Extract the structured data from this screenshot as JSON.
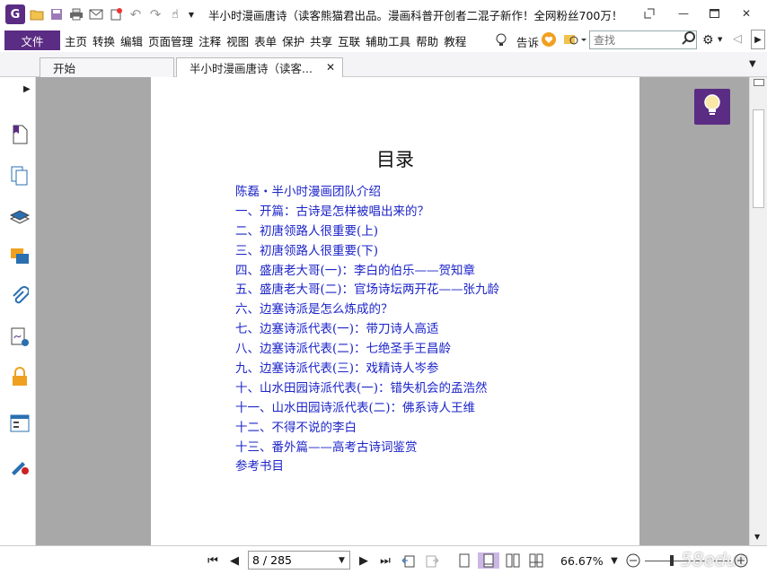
{
  "app": {
    "window_title": "半小时漫画唐诗（读客熊猫君出品。漫画科普开创者二混子新作！全网粉丝700万！",
    "accent_color": "#5b2c83",
    "icons": [
      "app-logo-icon",
      "open-folder-icon",
      "save-icon",
      "print-icon",
      "email-icon",
      "new-icon",
      "undo-icon",
      "redo-icon",
      "hand-tool-icon",
      "restore-icon",
      "minimize-icon",
      "maximize-icon",
      "close-icon"
    ]
  },
  "menubar": {
    "file": "文件",
    "items": [
      "主页",
      "转换",
      "编辑",
      "页面管理",
      "注释",
      "视图",
      "表单",
      "保护",
      "共享",
      "互联",
      "辅助工具",
      "帮助",
      "教程"
    ],
    "tell_label": "告诉",
    "search_placeholder": "查找"
  },
  "tabs": [
    {
      "label": "开始"
    },
    {
      "label": "半小时漫画唐诗（读客..."
    }
  ],
  "document": {
    "toc_title": "目录",
    "entries": [
      "陈磊・半小时漫画团队介绍",
      "一、开篇：古诗是怎样被唱出来的？",
      "二、初唐领路人很重要(上)",
      "三、初唐领路人很重要(下)",
      "四、盛唐老大哥(一)：李白的伯乐——贺知章",
      "五、盛唐老大哥(二)：官场诗坛两开花——张九龄",
      "六、边塞诗派是怎么炼成的？",
      "七、边塞诗派代表(一)：带刀诗人高适",
      "八、边塞诗派代表(二)：七绝圣手王昌龄",
      "九、边塞诗派代表(三)：戏精诗人岑参",
      "十、山水田园诗派代表(一)：错失机会的孟浩然",
      "十一、山水田园诗派代表(二)：佛系诗人王维",
      "十二、不得不说的李白",
      "十三、番外篇——高考古诗词鉴赏",
      "参考书目"
    ],
    "link_color": "#1c24c8"
  },
  "status": {
    "page_value": "8 / 285",
    "zoom": "66.67%",
    "watermark": "58educ"
  }
}
